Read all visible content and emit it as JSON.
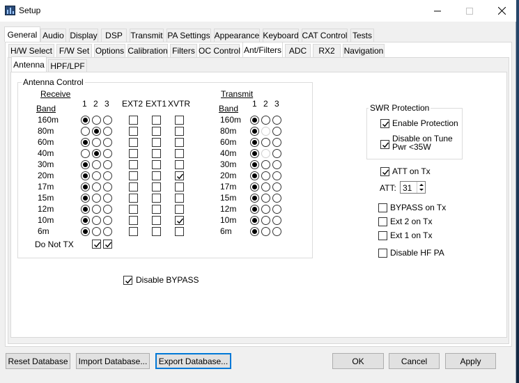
{
  "window": {
    "title": "Setup"
  },
  "tabs_top": [
    "General",
    "Audio",
    "Display",
    "DSP",
    "Transmit",
    "PA Settings",
    "Appearance",
    "Keyboard",
    "CAT Control",
    "Tests"
  ],
  "tabs_general": [
    "H/W Select",
    "F/W Set",
    "Options",
    "Calibration",
    "Filters",
    "OC Control",
    "Ant/Filters",
    "ADC",
    "RX2",
    "Navigation"
  ],
  "tabs_ant": [
    "Antenna",
    "HPF/LPF"
  ],
  "antenna_control": {
    "title": "Antenna Control",
    "receive": "Receive",
    "band": "Band",
    "transmit": "Transmit",
    "col_1": "1",
    "col_2": "2",
    "col_3": "3",
    "ext2": "EXT2",
    "ext1": "EXT1",
    "xvtr": "XVTR",
    "do_not_tx": "Do Not TX"
  },
  "bands": [
    "160m",
    "80m",
    "60m",
    "40m",
    "30m",
    "20m",
    "17m",
    "15m",
    "12m",
    "10m",
    "6m"
  ],
  "swr": {
    "title": "SWR Protection",
    "enable": "Enable Protection",
    "disable_tune_1": "Disable on Tune",
    "disable_tune_2": "Pwr <35W"
  },
  "att_on_tx": "ATT on Tx",
  "att": {
    "label": "ATT:",
    "value": "31"
  },
  "bypass_on_tx": "BYPASS on Tx",
  "ext2_on_tx": "Ext 2 on Tx",
  "ext1_on_tx": "Ext 1 on Tx",
  "disable_hf_pa": "Disable HF PA",
  "disable_bypass": "Disable BYPASS",
  "buttons": {
    "reset": "Reset Database",
    "import": "Import Database...",
    "export": "Export Database...",
    "ok": "OK",
    "cancel": "Cancel",
    "apply": "Apply"
  }
}
